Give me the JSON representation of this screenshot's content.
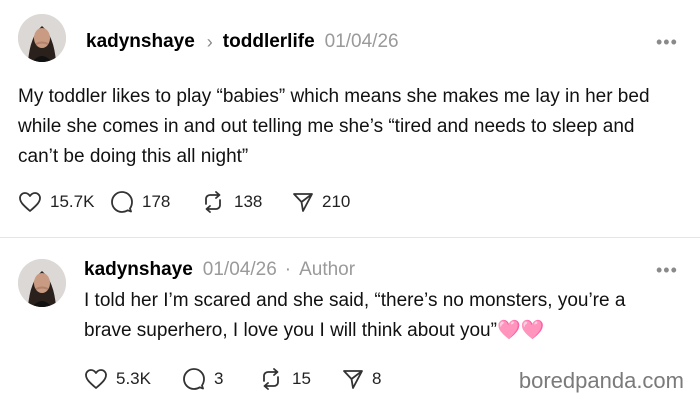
{
  "post": {
    "username": "kadynshaye",
    "topic": "toddlerlife",
    "date": "01/04/26",
    "more": "•••",
    "text": "My toddler likes to play “babies” which means she makes me lay in her bed while she comes in and out telling me she’s “tired and needs to sleep and can’t be doing this all night”",
    "likes": "15.7K",
    "replies": "178",
    "reposts": "138",
    "shares": "210"
  },
  "reply": {
    "username": "kadynshaye",
    "date": "01/04/26",
    "separator": "·",
    "badge": "Author",
    "more": "•••",
    "text": "I told her I’m scared and she said, “there’s no monsters, you’re a brave superhero, I love you I will think about you”🩷🩷",
    "likes": "5.3K",
    "replies": "3",
    "reposts": "15",
    "shares": "8"
  },
  "watermark": "boredpanda.com",
  "icons": {
    "like": "heart-icon",
    "reply": "comment-icon",
    "repost": "repost-icon",
    "share": "send-icon",
    "more": "more-icon",
    "topic_sep": "chevron-right-icon"
  }
}
